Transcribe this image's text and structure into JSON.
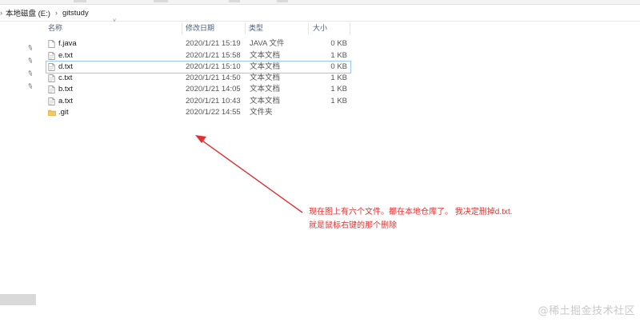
{
  "addressbar": {
    "segments": [
      "本地磁盘 (E:)",
      "gitstudy"
    ]
  },
  "columns": {
    "name": "名称",
    "modified": "修改日期",
    "type": "类型",
    "size": "大小"
  },
  "files": [
    {
      "name": "f.java",
      "modified": "2020/1/21 15:19",
      "type": "JAVA 文件",
      "size": "0 KB",
      "icon": "file-icon"
    },
    {
      "name": "e.txt",
      "modified": "2020/1/21 15:58",
      "type": "文本文档",
      "size": "1 KB",
      "icon": "file-icon"
    },
    {
      "name": "d.txt",
      "modified": "2020/1/21 15:10",
      "type": "文本文档",
      "size": "0 KB",
      "icon": "file-icon",
      "selected": true
    },
    {
      "name": "c.txt",
      "modified": "2020/1/21 14:50",
      "type": "文本文档",
      "size": "1 KB",
      "icon": "file-icon"
    },
    {
      "name": "b.txt",
      "modified": "2020/1/21 14:05",
      "type": "文本文档",
      "size": "1 KB",
      "icon": "file-icon"
    },
    {
      "name": "a.txt",
      "modified": "2020/1/21 10:43",
      "type": "文本文档",
      "size": "1 KB",
      "icon": "file-icon"
    },
    {
      "name": ".git",
      "modified": "2020/1/22 14:55",
      "type": "文件夹",
      "size": "",
      "icon": "folder-icon"
    }
  ],
  "annotation": {
    "line1": "现在图上有六个文件。都在本地仓库了。 我决定删掉d.txt.",
    "line2": "就是鼠标右键的那个删除",
    "color": "#e03131"
  },
  "watermark": "@稀土掘金技术社区"
}
